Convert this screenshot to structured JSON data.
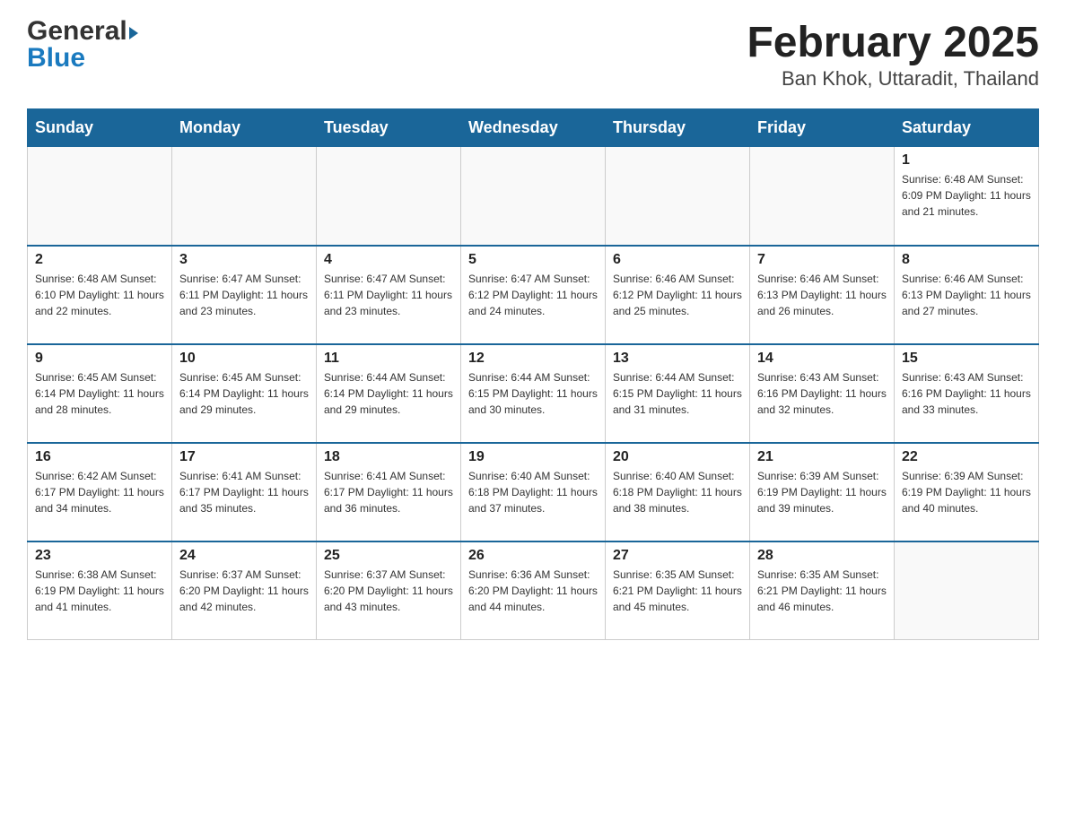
{
  "header": {
    "logo_general": "General",
    "logo_blue": "Blue",
    "title": "February 2025",
    "subtitle": "Ban Khok, Uttaradit, Thailand"
  },
  "weekdays": [
    "Sunday",
    "Monday",
    "Tuesday",
    "Wednesday",
    "Thursday",
    "Friday",
    "Saturday"
  ],
  "weeks": [
    [
      {
        "day": "",
        "info": ""
      },
      {
        "day": "",
        "info": ""
      },
      {
        "day": "",
        "info": ""
      },
      {
        "day": "",
        "info": ""
      },
      {
        "day": "",
        "info": ""
      },
      {
        "day": "",
        "info": ""
      },
      {
        "day": "1",
        "info": "Sunrise: 6:48 AM\nSunset: 6:09 PM\nDaylight: 11 hours and 21 minutes."
      }
    ],
    [
      {
        "day": "2",
        "info": "Sunrise: 6:48 AM\nSunset: 6:10 PM\nDaylight: 11 hours and 22 minutes."
      },
      {
        "day": "3",
        "info": "Sunrise: 6:47 AM\nSunset: 6:11 PM\nDaylight: 11 hours and 23 minutes."
      },
      {
        "day": "4",
        "info": "Sunrise: 6:47 AM\nSunset: 6:11 PM\nDaylight: 11 hours and 23 minutes."
      },
      {
        "day": "5",
        "info": "Sunrise: 6:47 AM\nSunset: 6:12 PM\nDaylight: 11 hours and 24 minutes."
      },
      {
        "day": "6",
        "info": "Sunrise: 6:46 AM\nSunset: 6:12 PM\nDaylight: 11 hours and 25 minutes."
      },
      {
        "day": "7",
        "info": "Sunrise: 6:46 AM\nSunset: 6:13 PM\nDaylight: 11 hours and 26 minutes."
      },
      {
        "day": "8",
        "info": "Sunrise: 6:46 AM\nSunset: 6:13 PM\nDaylight: 11 hours and 27 minutes."
      }
    ],
    [
      {
        "day": "9",
        "info": "Sunrise: 6:45 AM\nSunset: 6:14 PM\nDaylight: 11 hours and 28 minutes."
      },
      {
        "day": "10",
        "info": "Sunrise: 6:45 AM\nSunset: 6:14 PM\nDaylight: 11 hours and 29 minutes."
      },
      {
        "day": "11",
        "info": "Sunrise: 6:44 AM\nSunset: 6:14 PM\nDaylight: 11 hours and 29 minutes."
      },
      {
        "day": "12",
        "info": "Sunrise: 6:44 AM\nSunset: 6:15 PM\nDaylight: 11 hours and 30 minutes."
      },
      {
        "day": "13",
        "info": "Sunrise: 6:44 AM\nSunset: 6:15 PM\nDaylight: 11 hours and 31 minutes."
      },
      {
        "day": "14",
        "info": "Sunrise: 6:43 AM\nSunset: 6:16 PM\nDaylight: 11 hours and 32 minutes."
      },
      {
        "day": "15",
        "info": "Sunrise: 6:43 AM\nSunset: 6:16 PM\nDaylight: 11 hours and 33 minutes."
      }
    ],
    [
      {
        "day": "16",
        "info": "Sunrise: 6:42 AM\nSunset: 6:17 PM\nDaylight: 11 hours and 34 minutes."
      },
      {
        "day": "17",
        "info": "Sunrise: 6:41 AM\nSunset: 6:17 PM\nDaylight: 11 hours and 35 minutes."
      },
      {
        "day": "18",
        "info": "Sunrise: 6:41 AM\nSunset: 6:17 PM\nDaylight: 11 hours and 36 minutes."
      },
      {
        "day": "19",
        "info": "Sunrise: 6:40 AM\nSunset: 6:18 PM\nDaylight: 11 hours and 37 minutes."
      },
      {
        "day": "20",
        "info": "Sunrise: 6:40 AM\nSunset: 6:18 PM\nDaylight: 11 hours and 38 minutes."
      },
      {
        "day": "21",
        "info": "Sunrise: 6:39 AM\nSunset: 6:19 PM\nDaylight: 11 hours and 39 minutes."
      },
      {
        "day": "22",
        "info": "Sunrise: 6:39 AM\nSunset: 6:19 PM\nDaylight: 11 hours and 40 minutes."
      }
    ],
    [
      {
        "day": "23",
        "info": "Sunrise: 6:38 AM\nSunset: 6:19 PM\nDaylight: 11 hours and 41 minutes."
      },
      {
        "day": "24",
        "info": "Sunrise: 6:37 AM\nSunset: 6:20 PM\nDaylight: 11 hours and 42 minutes."
      },
      {
        "day": "25",
        "info": "Sunrise: 6:37 AM\nSunset: 6:20 PM\nDaylight: 11 hours and 43 minutes."
      },
      {
        "day": "26",
        "info": "Sunrise: 6:36 AM\nSunset: 6:20 PM\nDaylight: 11 hours and 44 minutes."
      },
      {
        "day": "27",
        "info": "Sunrise: 6:35 AM\nSunset: 6:21 PM\nDaylight: 11 hours and 45 minutes."
      },
      {
        "day": "28",
        "info": "Sunrise: 6:35 AM\nSunset: 6:21 PM\nDaylight: 11 hours and 46 minutes."
      },
      {
        "day": "",
        "info": ""
      }
    ]
  ]
}
